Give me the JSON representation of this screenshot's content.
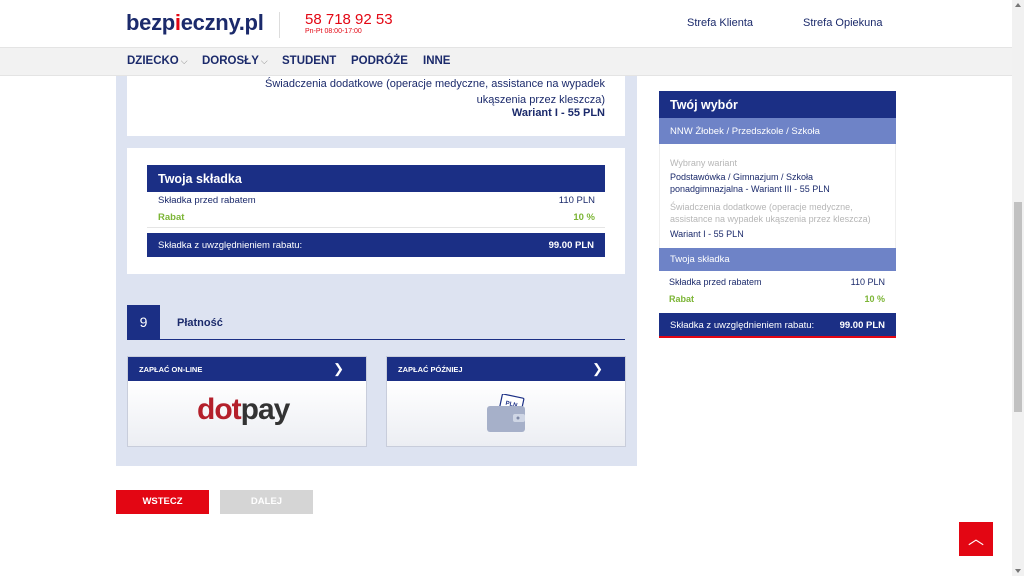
{
  "header": {
    "logo_part1": "bezp",
    "logo_accent": "i",
    "logo_part2": "eczny.pl",
    "phone": "58 718 92 53",
    "hours": "Pn-Pt 08:00-17:00",
    "links": [
      "Strefa Klienta",
      "Strefa Opiekuna"
    ]
  },
  "nav": {
    "items": [
      {
        "label": "DZIECKO",
        "has_dropdown": true
      },
      {
        "label": "DOROSŁY",
        "has_dropdown": true
      },
      {
        "label": "STUDENT",
        "has_dropdown": false
      },
      {
        "label": "PODRÓŻE",
        "has_dropdown": false
      },
      {
        "label": "INNE",
        "has_dropdown": false
      }
    ]
  },
  "extras": {
    "label": "Świadczenia dodatkowe (operacje medyczne, assistance na wypadek ukąszenia przez kleszcza)",
    "value": "Wariant I - 55 PLN"
  },
  "premium": {
    "title": "Twoja składka",
    "before_label": "Składka przed rabatem",
    "before_value": "110 PLN",
    "rabat_label": "Rabat",
    "rabat_value": "10 %",
    "total_label": "Składka z uwzględnieniem rabatu:",
    "total_value": "99.00 PLN"
  },
  "payment_step": {
    "number": "9",
    "title": "Płatność",
    "options": [
      {
        "label": "ZAPŁAĆ ON-LINE",
        "brand": "dotpay"
      },
      {
        "label": "ZAPŁAĆ PÓŹNIEJ",
        "icon": "wallet-icon",
        "icon_text": "PLN"
      }
    ]
  },
  "buttons": {
    "back": "WSTECZ",
    "next": "DALEJ"
  },
  "sidebar": {
    "title": "Twój wybór",
    "product": "NNW Żłobek / Przedszkole / Szkoła",
    "variant_label": "Wybrany wariant",
    "variant_value": "Podstawówka / Gimnazjum / Szkoła ponadgimnazjalna - Wariant III - 55 PLN",
    "extras_label": "Świadczenia dodatkowe (operacje medyczne, assistance na wypadek ukąszenia przez kleszcza)",
    "extras_value": "Wariant I - 55 PLN",
    "premium_title": "Twoja składka",
    "before_label": "Składka przed rabatem",
    "before_value": "110 PLN",
    "rabat_label": "Rabat",
    "rabat_value": "10 %",
    "total_label": "Składka z uwzględnieniem rabatu:",
    "total_value": "99.00 PLN"
  },
  "colors": {
    "navy": "#1b2f85",
    "light_blue": "#6e83c7",
    "red": "#e30613",
    "green": "#7cb536",
    "bg_blue": "#dde3f1"
  }
}
